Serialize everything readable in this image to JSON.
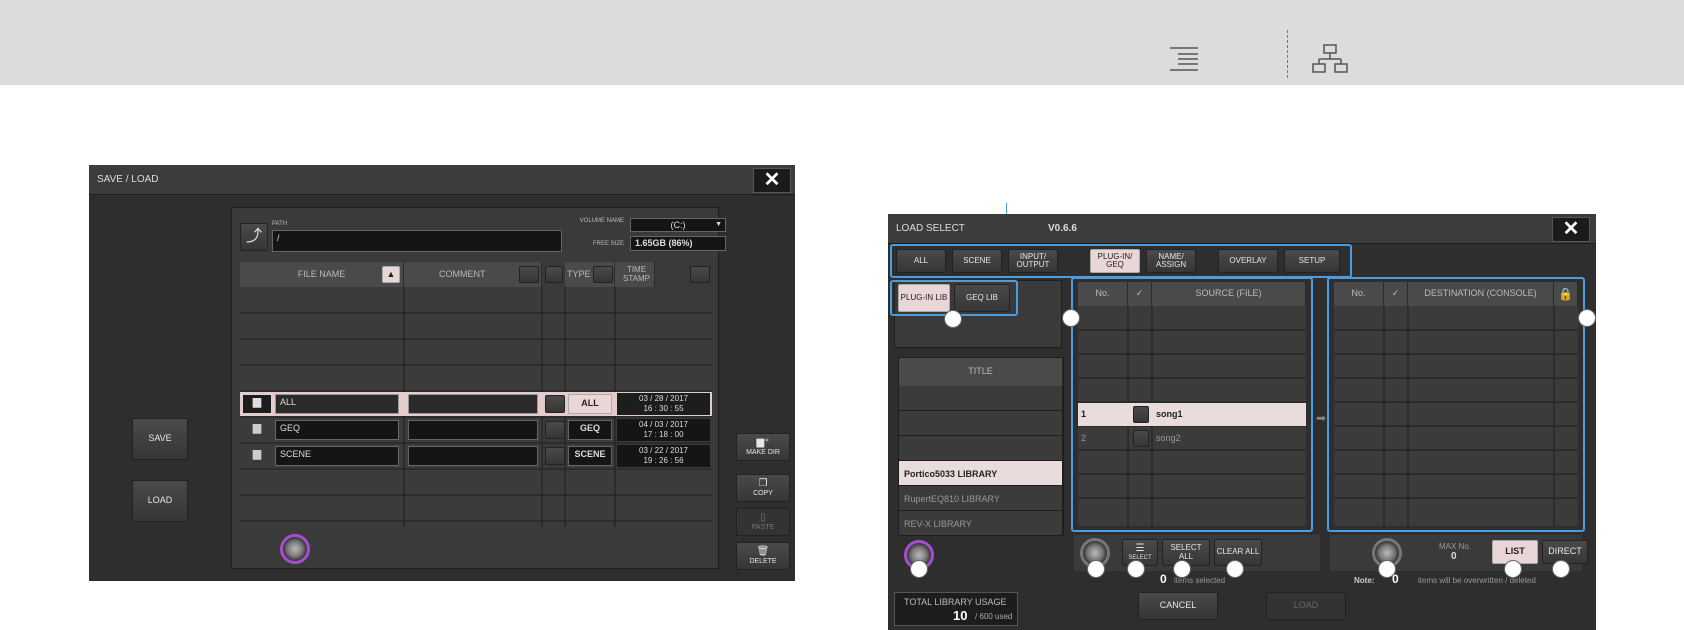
{
  "save_load": {
    "title": "SAVE / LOAD",
    "close_label": "✕",
    "path_label": "PATH",
    "path_value": "/",
    "volume_label": "VOLUME NAME",
    "volume_value": "(C:)",
    "free_size_label": "FREE SIZE",
    "free_size_value": "1.65GB (86%)",
    "columns": {
      "file_name": "FILE NAME",
      "comment": "COMMENT",
      "type": "TYPE",
      "time_stamp": "TIME STAMP"
    },
    "files": [
      {
        "name": "ALL",
        "type": "ALL",
        "date": "03 / 28 / 2017",
        "time": "16 : 30 : 55"
      },
      {
        "name": "GEQ",
        "type": "GEQ",
        "date": "04 / 03 / 2017",
        "time": "17 : 18 : 00"
      },
      {
        "name": "SCENE",
        "type": "SCENE",
        "date": "03 / 22 / 2017",
        "time": "19 : 26 : 56"
      }
    ],
    "buttons": {
      "save": "SAVE",
      "load": "LOAD",
      "make_dir": "MAKE DIR",
      "copy": "COPY",
      "paste": "PASTE",
      "delete": "DELETE"
    }
  },
  "load_select": {
    "title": "LOAD SELECT",
    "version": "V0.6.6",
    "close_label": "✕",
    "tabs": [
      "ALL",
      "SCENE",
      "INPUT/ OUTPUT",
      "PLUG-IN/ GEQ",
      "NAME/ ASSIGN",
      "OVERLAY",
      "SETUP"
    ],
    "lib_buttons": [
      "PLUG-IN LIB",
      "GEQ LIB"
    ],
    "title_header": "TITLE",
    "libraries": [
      "Portico5033 LIBRARY",
      "RupertEQ810 LIBRARY",
      "REV-X LIBRARY"
    ],
    "source_columns": {
      "no": "No.",
      "check": "✓",
      "source": "SOURCE (FILE)"
    },
    "source_rows": [
      {
        "no": "1",
        "name": "song1"
      },
      {
        "no": "2",
        "name": "song2"
      }
    ],
    "dest_columns": {
      "no": "No.",
      "check": "✓",
      "destination": "DESTINATION (CONSOLE)"
    },
    "select_label": "SELECT",
    "select_all": "SELECT ALL",
    "clear_all": "CLEAR ALL",
    "items_selected_count": "0",
    "items_selected_text": "items selected",
    "max_no_label": "MAX No.",
    "max_no_value": "0",
    "list_label": "LIST",
    "direct_label": "DIRECT",
    "note_label": "Note:",
    "note_count": "0",
    "note_text": "items will be overwritten / deleted",
    "usage_label": "TOTAL LIBRARY USAGE",
    "usage_value": "10",
    "usage_suffix": "/ 600 used",
    "cancel_label": "CANCEL",
    "load_label": "LOAD"
  },
  "colors": {
    "accent_frame": "#4a9ee0",
    "knob_ring": "#a84cd6",
    "selected_row": "#e9dcdc"
  }
}
